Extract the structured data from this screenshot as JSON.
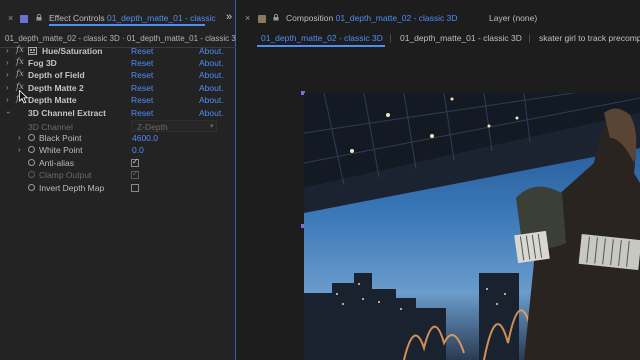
{
  "effect_controls": {
    "close_glyph": "×",
    "tab_prefix": "Effect Controls",
    "tab_comp": "01_depth_matte_01 - classic",
    "overflow_glyph": "»",
    "path_text": "01_depth_matte_02 - classic 3D · 01_depth_matte_01 - classic 3",
    "effects": [
      {
        "name": "Hue/Saturation",
        "reset": "Reset",
        "about": "About."
      },
      {
        "name": "Fog 3D",
        "reset": "Reset",
        "about": "About."
      },
      {
        "name": "Depth of Field",
        "reset": "Reset",
        "about": "About."
      },
      {
        "name": "Depth Matte 2",
        "reset": "Reset",
        "about": "About."
      },
      {
        "name": "Depth Matte",
        "reset": "Reset",
        "about": "About."
      },
      {
        "name": "3D Channel Extract",
        "reset": "Reset",
        "about": "About."
      }
    ],
    "channel_label": "3D Channel",
    "channel_value": "Z-Depth",
    "properties": {
      "black_point": {
        "label": "Black Point",
        "value": "4600.0"
      },
      "white_point": {
        "label": "White Point",
        "value": "0.0"
      },
      "anti_alias": {
        "label": "Anti-alias",
        "checked": "✓"
      },
      "clamp_output": {
        "label": "Clamp Output",
        "checked": "✓"
      },
      "invert_depth_map": {
        "label": "Invert Depth Map"
      }
    }
  },
  "composition": {
    "close_glyph": "×",
    "tab_prefix": "Composition",
    "tab_comp": "01_depth_matte_02 - classic 3D",
    "layer_tab": "Layer (none)",
    "subtabs": [
      "01_depth_matte_02 - classic 3D",
      "01_depth_matte_01 - classic 3D",
      "skater girl to track precomp"
    ]
  },
  "colors": {
    "accent": "#4e8ef7",
    "label_swatch_ec": "#6a72d8",
    "label_swatch_comp": "#8a7a5a"
  },
  "icons": [
    "close-icon",
    "lock-icon",
    "overflow-icon",
    "chevron-icon",
    "fx-icon",
    "stopwatch-icon",
    "checkbox-icon",
    "dropdown-arrow-icon",
    "cursor-icon"
  ]
}
